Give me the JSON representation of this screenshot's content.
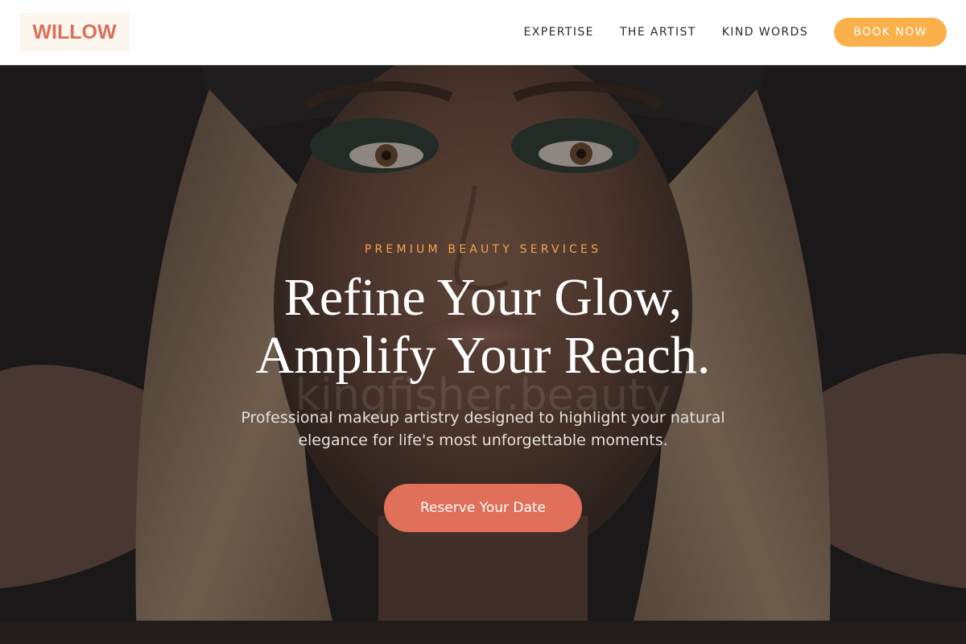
{
  "brand": {
    "logo_text": "WILLOW"
  },
  "nav": {
    "items": [
      {
        "label": "EXPERTISE"
      },
      {
        "label": "THE ARTIST"
      },
      {
        "label": "KIND WORDS"
      }
    ],
    "cta_label": "BOOK NOW"
  },
  "hero": {
    "eyebrow": "PREMIUM BEAUTY SERVICES",
    "headline_line1": "Refine Your Glow,",
    "headline_line2": "Amplify Your Reach.",
    "subtext": "Professional makeup artistry designed to highlight your natural elegance for life's most unforgettable moments.",
    "cta_label": "Reserve Your Date",
    "watermark": "kingfisher.beauty"
  },
  "colors": {
    "brand": "#d9705a",
    "book_button": "#fbb04a",
    "eyebrow": "#f4a54b",
    "cta": "#e0705a"
  },
  "icons": {
    "hero_image": "portrait-photo"
  }
}
